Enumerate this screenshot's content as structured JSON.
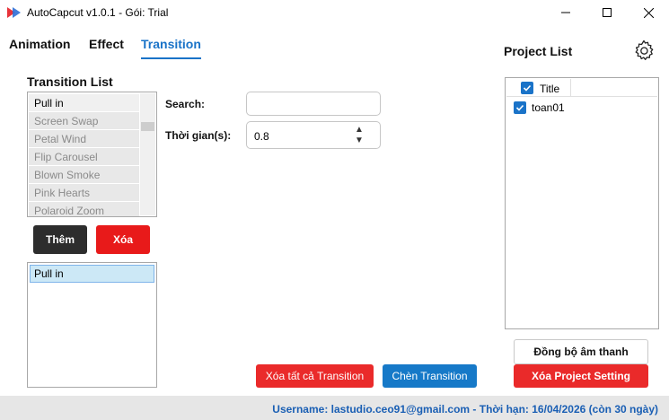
{
  "window": {
    "title": "AutoCapcut v1.0.1 - Gói: Trial"
  },
  "tabs": [
    {
      "label": "Animation",
      "active": false
    },
    {
      "label": "Effect",
      "active": false
    },
    {
      "label": "Transition",
      "active": true
    }
  ],
  "transition_panel": {
    "title": "Transition List",
    "items": [
      "Pull in",
      "Screen Swap",
      "Petal Wind",
      "Flip Carousel",
      "Blown Smoke",
      "Pink Hearts",
      "Polaroid Zoom"
    ],
    "add_button": "Thêm",
    "delete_button": "Xóa",
    "added_items": [
      "Pull in"
    ]
  },
  "form": {
    "search_label": "Search:",
    "search_value": "",
    "duration_label": "Thời gian(s):",
    "duration_value": "0.8"
  },
  "actions": {
    "clear_all_transition": "Xóa tất cả Transition",
    "insert_transition": "Chèn Transition"
  },
  "project_panel": {
    "title": "Project List",
    "column_title": "Title",
    "projects": [
      {
        "name": "toan01",
        "checked": true
      }
    ],
    "sync_audio_button": "Đồng bộ âm thanh",
    "clear_project_setting_button": "Xóa Project Setting"
  },
  "footer": {
    "status_text": "Username: lastudio.ceo91@gmail.com - Thời hạn: 16/04/2026 (còn 30 ngày)"
  },
  "colors": {
    "accent": "#1a73c8",
    "danger": "#ea2a2a",
    "dark_button": "#2d2d2d"
  }
}
